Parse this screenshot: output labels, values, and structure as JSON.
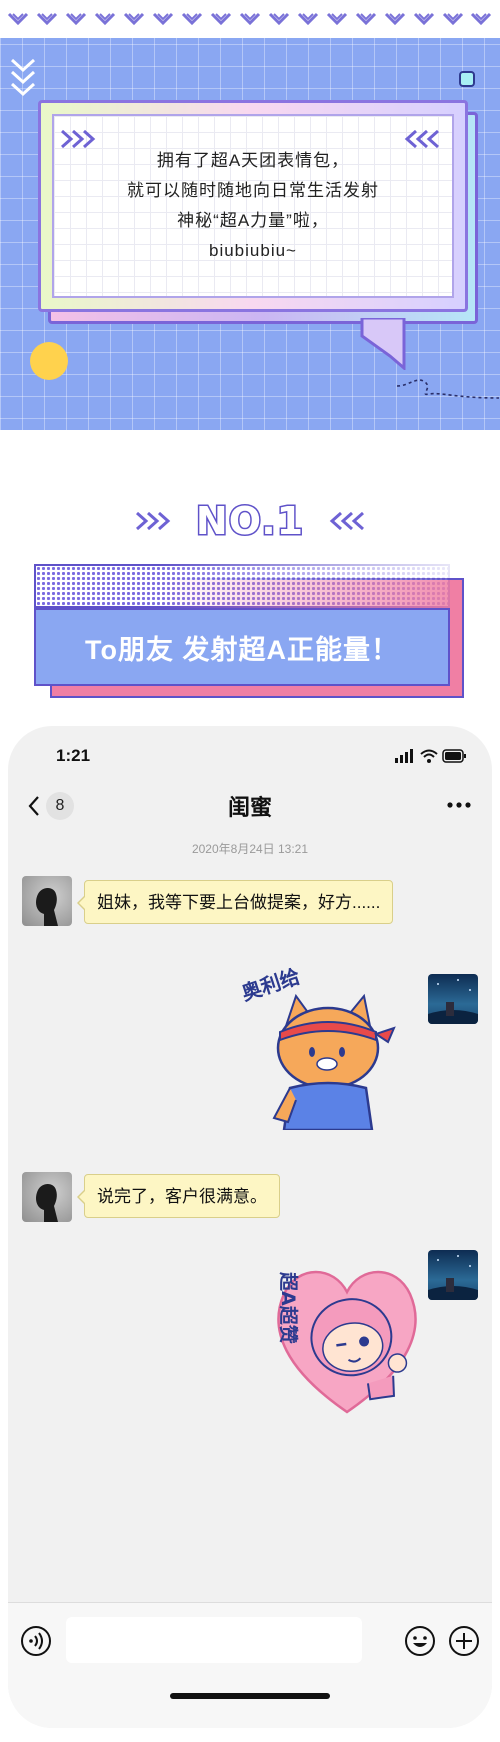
{
  "hero": {
    "lines": [
      "拥有了超A天团表情包，",
      "就可以随时随地向日常生活发射",
      "神秘“超A力量”啦，",
      "biubiubiu~"
    ]
  },
  "section": {
    "number_label": "NO.1",
    "banner_text": "To朋友  发射超A正能量！"
  },
  "colors": {
    "hero_bg": "#8aa7f2",
    "accent_purple": "#5f52c9",
    "accent_pink": "#f07fa4",
    "bubble_yellow": "#fdf6c4"
  },
  "phone": {
    "status_time": "1:21",
    "nav": {
      "back_icon": "chevron-left-icon",
      "unread_count": "8",
      "title": "闺蜜",
      "more_icon": "more-dots-icon"
    },
    "timestamp": "2020年8月24日 13:21",
    "messages": [
      {
        "side": "left",
        "type": "text",
        "text": "姐妹，我等下要上台做提案，好方......"
      },
      {
        "side": "right",
        "type": "sticker",
        "sticker_text": "奥利给"
      },
      {
        "side": "left",
        "type": "text",
        "text": "说完了，客户很满意。"
      },
      {
        "side": "right",
        "type": "sticker",
        "sticker_text": "超A超赞"
      }
    ],
    "input_bar": {
      "voice_icon": "voice-icon",
      "input_value": "",
      "emoji_icon": "emoji-icon",
      "plus_icon": "plus-icon"
    }
  }
}
